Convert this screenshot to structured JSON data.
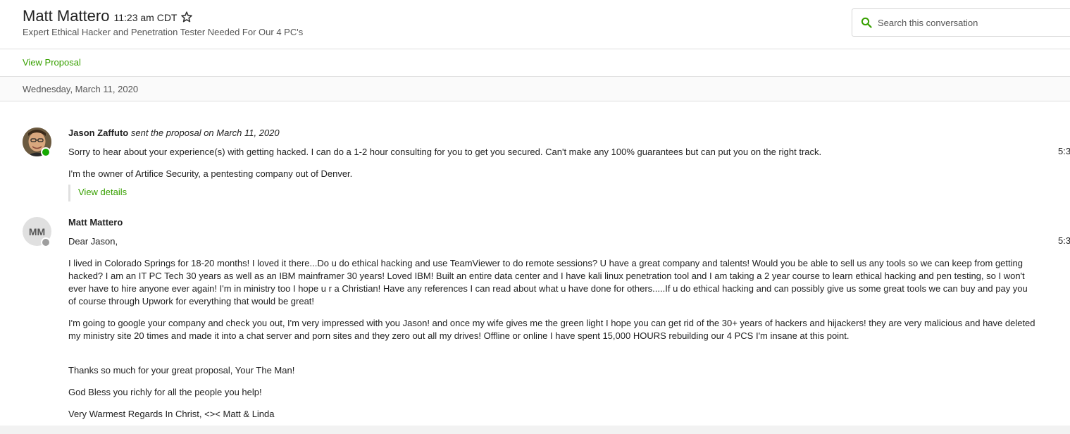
{
  "header": {
    "contact_name": "Matt Mattero",
    "time": "11:23 am CDT",
    "job_title": "Expert Ethical Hacker and Penetration Tester Needed For Our 4 PC's",
    "star_icon": "star-outline-icon"
  },
  "search": {
    "placeholder": "Search this conversation",
    "icon": "search-icon"
  },
  "proposal_bar": {
    "link_label": "View Proposal"
  },
  "date_divider": "Wednesday, March 11, 2020",
  "messages": [
    {
      "sender": "Jason Zaffuto",
      "action": "sent the proposal on March 11, 2020",
      "status": "online",
      "time": "5:3",
      "paragraphs": [
        "Sorry to hear about your experience(s) with getting hacked. I can do a 1-2 hour consulting for you to get you secured. Can't make any 100% guarantees but can put you on the right track.",
        "I'm the owner of Artifice Security, a pentesting company out of Denver."
      ],
      "details_label": "View details"
    },
    {
      "sender": "Matt Mattero",
      "avatar_initials": "MM",
      "status": "offline",
      "time": "5:3",
      "paragraphs": [
        "Dear Jason,",
        "I lived in Colorado Springs for 18-20 months! I loved it there...Do u do ethical hacking and use TeamViewer to do remote sessions? U have a great company and talents! Would you be able to sell us any tools so we can keep from getting hacked? I am an IT PC Tech 30 years as well as an IBM mainframer 30 years! Loved IBM! Built an entire data center and I have kali linux penetration tool and I am taking a 2 year course to learn ethical hacking and pen testing, so I won't ever have to hire anyone ever again! I'm in ministry too I hope u r a Christian! Have any references I can read about what u have done for others.....If u do ethical hacking and can possibly give us some great tools we can buy and pay you of course through Upwork for everything that would be great!",
        "I'm going to google your company and check you out, I'm very impressed with you Jason! and once my wife gives me the green light I hope you can get rid of the 30+ years of hackers and hijackers! they are very malicious and have deleted my ministry site 20 times and made it into a chat server and porn sites and they zero out all my drives! Offline or online I have spent 15,000 HOURS rebuilding our 4 PCS I'm insane at this point.",
        "Thanks so much for your great proposal, Your The Man!",
        "God Bless you richly for all the people you help!",
        "Very Warmest Regards In Christ, <>< Matt & Linda"
      ]
    }
  ],
  "colors": {
    "accent_green": "#37a000",
    "online_green": "#14a800",
    "offline_gray": "#9e9e9e",
    "border": "#e0e0e0"
  }
}
